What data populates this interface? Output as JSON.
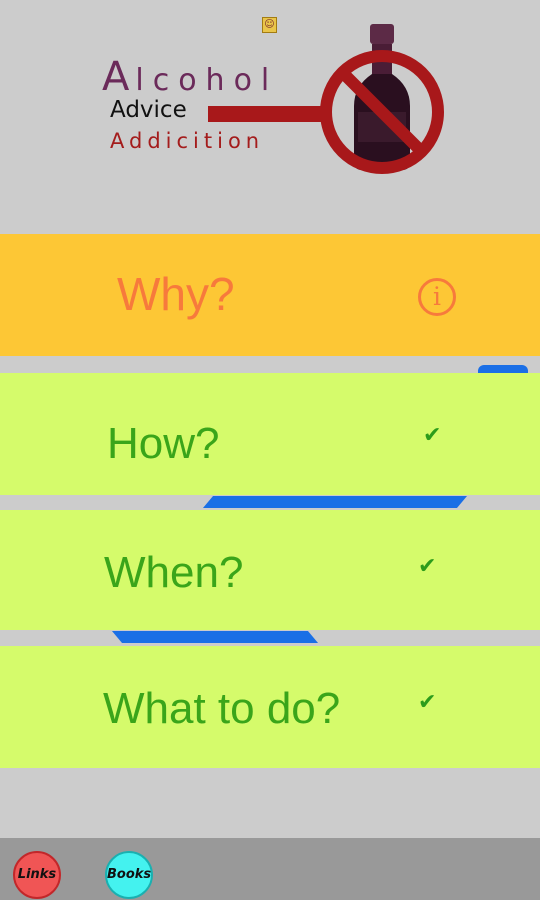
{
  "header": {
    "status_icon": "notification-icon",
    "logo": {
      "alcohol_first": "A",
      "alcohol_rest": "lcohol",
      "advice": "Advice",
      "addiction": "Addicition"
    }
  },
  "menu": {
    "why": {
      "label": "Why?",
      "icon": "info-icon"
    },
    "how": {
      "label": "How?",
      "icon": "check-icon"
    },
    "when": {
      "label": "When?",
      "icon": "check-icon"
    },
    "what": {
      "label": "What to do?",
      "icon": "check-icon"
    }
  },
  "bottom": {
    "links_label": "Links",
    "books_label": "Books"
  },
  "colors": {
    "background": "#cccccc",
    "why_panel": "#fdc735",
    "answer_panel": "#d5fb6b",
    "why_text": "#f77a3c",
    "answer_text": "#3aa51a",
    "accent_stripe": "#1a6fe6",
    "links_button": "#f05555",
    "books_button": "#44f2ef"
  }
}
